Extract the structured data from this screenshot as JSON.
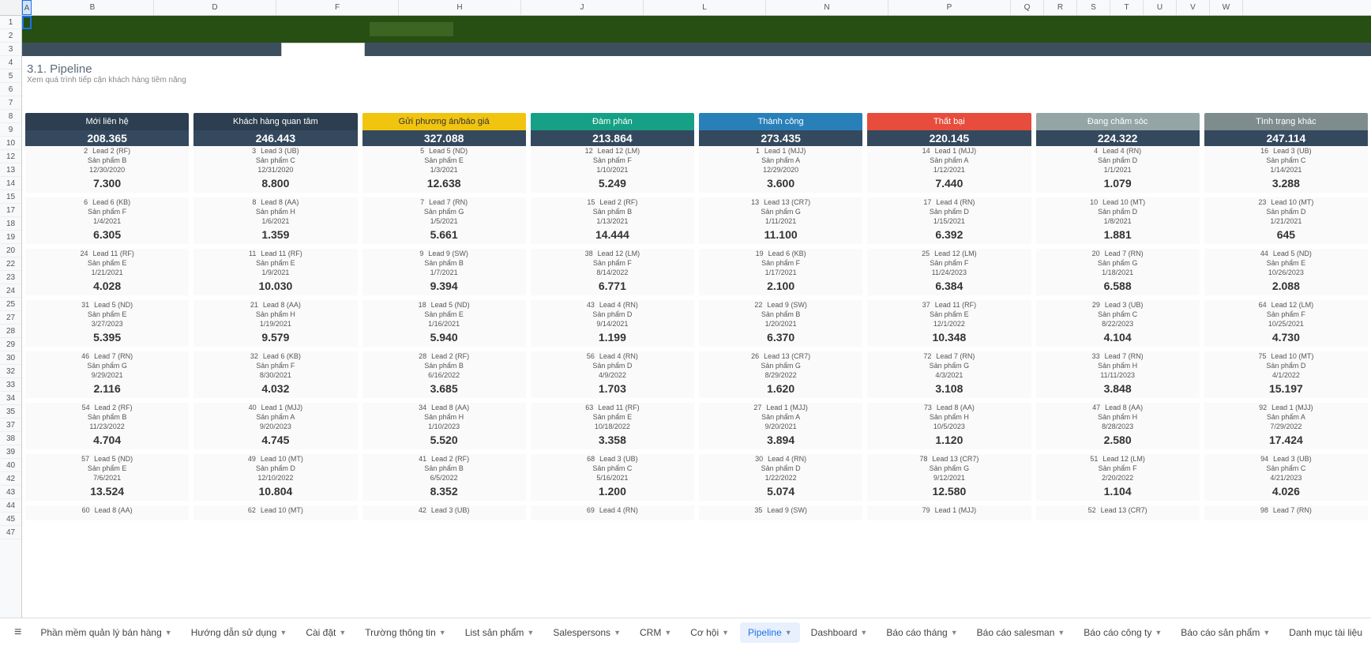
{
  "col_letters": [
    "A",
    "B",
    "D",
    "F",
    "H",
    "J",
    "L",
    "N",
    "P",
    "Q",
    "R",
    "S",
    "T",
    "U",
    "V",
    "W"
  ],
  "row_numbers": [
    1,
    2,
    3,
    4,
    5,
    6,
    7,
    8,
    9,
    10,
    12,
    13,
    14,
    15,
    17,
    18,
    19,
    20,
    22,
    23,
    24,
    25,
    27,
    28,
    29,
    30,
    32,
    33,
    34,
    35,
    37,
    38,
    39,
    40,
    42,
    43,
    44,
    45,
    47
  ],
  "section": {
    "title": "3.1. Pipeline",
    "subtitle": "Xem quá trình tiếp cận khách hàng tiềm năng"
  },
  "stages": [
    {
      "name": "Mới liên hệ",
      "total": "208.365",
      "hclass": "c1",
      "cards": [
        {
          "n": "2",
          "lead": "Lead 2 (RF)",
          "prod": "Sản phẩm B",
          "date": "12/30/2020",
          "val": "7.300"
        },
        {
          "n": "6",
          "lead": "Lead 6 (KB)",
          "prod": "Sản phẩm F",
          "date": "1/4/2021",
          "val": "6.305"
        },
        {
          "n": "24",
          "lead": "Lead 11 (RF)",
          "prod": "Sản phẩm E",
          "date": "1/21/2021",
          "val": "4.028"
        },
        {
          "n": "31",
          "lead": "Lead 5 (ND)",
          "prod": "Sản phẩm E",
          "date": "3/27/2023",
          "val": "5.395"
        },
        {
          "n": "46",
          "lead": "Lead 7 (RN)",
          "prod": "Sản phẩm G",
          "date": "9/29/2021",
          "val": "2.116"
        },
        {
          "n": "54",
          "lead": "Lead 2 (RF)",
          "prod": "Sản phẩm B",
          "date": "11/23/2022",
          "val": "4.704"
        },
        {
          "n": "57",
          "lead": "Lead 5 (ND)",
          "prod": "Sản phẩm E",
          "date": "7/6/2021",
          "val": "13.524"
        },
        {
          "n": "60",
          "lead": "Lead 8 (AA)",
          "prod": "",
          "date": "",
          "val": ""
        }
      ]
    },
    {
      "name": "Khách hàng quan tâm",
      "total": "246.443",
      "hclass": "c2",
      "cards": [
        {
          "n": "3",
          "lead": "Lead 3 (UB)",
          "prod": "Sản phẩm C",
          "date": "12/31/2020",
          "val": "8.800"
        },
        {
          "n": "8",
          "lead": "Lead 8 (AA)",
          "prod": "Sản phẩm H",
          "date": "1/6/2021",
          "val": "1.359"
        },
        {
          "n": "11",
          "lead": "Lead 11 (RF)",
          "prod": "Sản phẩm E",
          "date": "1/9/2021",
          "val": "10.030"
        },
        {
          "n": "21",
          "lead": "Lead 8 (AA)",
          "prod": "Sản phẩm H",
          "date": "1/19/2021",
          "val": "9.579"
        },
        {
          "n": "32",
          "lead": "Lead 6 (KB)",
          "prod": "Sản phẩm F",
          "date": "8/30/2021",
          "val": "4.032"
        },
        {
          "n": "40",
          "lead": "Lead 1 (MJJ)",
          "prod": "Sản phẩm A",
          "date": "9/20/2023",
          "val": "4.745"
        },
        {
          "n": "49",
          "lead": "Lead 10 (MT)",
          "prod": "Sản phẩm D",
          "date": "12/10/2022",
          "val": "10.804"
        },
        {
          "n": "62",
          "lead": "Lead 10 (MT)",
          "prod": "",
          "date": "",
          "val": ""
        }
      ]
    },
    {
      "name": "Gửi phương án/báo giá",
      "total": "327.088",
      "hclass": "c3",
      "cards": [
        {
          "n": "5",
          "lead": "Lead 5 (ND)",
          "prod": "Sản phẩm E",
          "date": "1/3/2021",
          "val": "12.638"
        },
        {
          "n": "7",
          "lead": "Lead 7 (RN)",
          "prod": "Sản phẩm G",
          "date": "1/5/2021",
          "val": "5.661"
        },
        {
          "n": "9",
          "lead": "Lead 9 (SW)",
          "prod": "Sản phẩm B",
          "date": "1/7/2021",
          "val": "9.394"
        },
        {
          "n": "18",
          "lead": "Lead 5 (ND)",
          "prod": "Sản phẩm E",
          "date": "1/16/2021",
          "val": "5.940"
        },
        {
          "n": "28",
          "lead": "Lead 2 (RF)",
          "prod": "Sản phẩm B",
          "date": "6/16/2022",
          "val": "3.685"
        },
        {
          "n": "34",
          "lead": "Lead 8 (AA)",
          "prod": "Sản phẩm H",
          "date": "1/10/2023",
          "val": "5.520"
        },
        {
          "n": "41",
          "lead": "Lead 2 (RF)",
          "prod": "Sản phẩm B",
          "date": "6/5/2022",
          "val": "8.352"
        },
        {
          "n": "42",
          "lead": "Lead 3 (UB)",
          "prod": "",
          "date": "",
          "val": ""
        }
      ]
    },
    {
      "name": "Đàm phán",
      "total": "213.864",
      "hclass": "c4",
      "cards": [
        {
          "n": "12",
          "lead": "Lead 12 (LM)",
          "prod": "Sản phẩm F",
          "date": "1/10/2021",
          "val": "5.249"
        },
        {
          "n": "15",
          "lead": "Lead 2 (RF)",
          "prod": "Sản phẩm B",
          "date": "1/13/2021",
          "val": "14.444"
        },
        {
          "n": "38",
          "lead": "Lead 12 (LM)",
          "prod": "Sản phẩm F",
          "date": "8/14/2022",
          "val": "6.771"
        },
        {
          "n": "43",
          "lead": "Lead 4 (RN)",
          "prod": "Sản phẩm D",
          "date": "9/14/2021",
          "val": "1.199"
        },
        {
          "n": "56",
          "lead": "Lead 4 (RN)",
          "prod": "Sản phẩm D",
          "date": "4/9/2022",
          "val": "1.703"
        },
        {
          "n": "63",
          "lead": "Lead 11 (RF)",
          "prod": "Sản phẩm E",
          "date": "10/18/2022",
          "val": "3.358"
        },
        {
          "n": "68",
          "lead": "Lead 3 (UB)",
          "prod": "Sản phẩm C",
          "date": "5/16/2021",
          "val": "1.200"
        },
        {
          "n": "69",
          "lead": "Lead 4 (RN)",
          "prod": "",
          "date": "",
          "val": ""
        }
      ]
    },
    {
      "name": "Thành công",
      "total": "273.435",
      "hclass": "c5",
      "cards": [
        {
          "n": "1",
          "lead": "Lead 1 (MJJ)",
          "prod": "Sản phẩm A",
          "date": "12/29/2020",
          "val": "3.600"
        },
        {
          "n": "13",
          "lead": "Lead 13 (CR7)",
          "prod": "Sản phẩm G",
          "date": "1/11/2021",
          "val": "11.100"
        },
        {
          "n": "19",
          "lead": "Lead 6 (KB)",
          "prod": "Sản phẩm F",
          "date": "1/17/2021",
          "val": "2.100"
        },
        {
          "n": "22",
          "lead": "Lead 9 (SW)",
          "prod": "Sản phẩm B",
          "date": "1/20/2021",
          "val": "6.370"
        },
        {
          "n": "26",
          "lead": "Lead 13 (CR7)",
          "prod": "Sản phẩm G",
          "date": "8/29/2022",
          "val": "1.620"
        },
        {
          "n": "27",
          "lead": "Lead 1 (MJJ)",
          "prod": "Sản phẩm A",
          "date": "9/20/2021",
          "val": "3.894"
        },
        {
          "n": "30",
          "lead": "Lead 4 (RN)",
          "prod": "Sản phẩm D",
          "date": "1/22/2022",
          "val": "5.074"
        },
        {
          "n": "35",
          "lead": "Lead 9 (SW)",
          "prod": "",
          "date": "",
          "val": ""
        }
      ]
    },
    {
      "name": "Thất bại",
      "total": "220.145",
      "hclass": "c6",
      "cards": [
        {
          "n": "14",
          "lead": "Lead 1 (MJJ)",
          "prod": "Sản phẩm A",
          "date": "1/12/2021",
          "val": "7.440"
        },
        {
          "n": "17",
          "lead": "Lead 4 (RN)",
          "prod": "Sản phẩm D",
          "date": "1/15/2021",
          "val": "6.392"
        },
        {
          "n": "25",
          "lead": "Lead 12 (LM)",
          "prod": "Sản phẩm F",
          "date": "11/24/2023",
          "val": "6.384"
        },
        {
          "n": "37",
          "lead": "Lead 11 (RF)",
          "prod": "Sản phẩm E",
          "date": "12/1/2022",
          "val": "10.348"
        },
        {
          "n": "72",
          "lead": "Lead 7 (RN)",
          "prod": "Sản phẩm G",
          "date": "4/3/2021",
          "val": "3.108"
        },
        {
          "n": "73",
          "lead": "Lead 8 (AA)",
          "prod": "Sản phẩm H",
          "date": "10/5/2023",
          "val": "1.120"
        },
        {
          "n": "78",
          "lead": "Lead 13 (CR7)",
          "prod": "Sản phẩm G",
          "date": "9/12/2021",
          "val": "12.580"
        },
        {
          "n": "79",
          "lead": "Lead 1 (MJJ)",
          "prod": "",
          "date": "",
          "val": ""
        }
      ]
    },
    {
      "name": "Đang chăm sóc",
      "total": "224.322",
      "hclass": "c7",
      "cards": [
        {
          "n": "4",
          "lead": "Lead 4 (RN)",
          "prod": "Sản phẩm D",
          "date": "1/1/2021",
          "val": "1.079"
        },
        {
          "n": "10",
          "lead": "Lead 10 (MT)",
          "prod": "Sản phẩm D",
          "date": "1/8/2021",
          "val": "1.881"
        },
        {
          "n": "20",
          "lead": "Lead 7 (RN)",
          "prod": "Sản phẩm G",
          "date": "1/18/2021",
          "val": "6.588"
        },
        {
          "n": "29",
          "lead": "Lead 3 (UB)",
          "prod": "Sản phẩm C",
          "date": "8/22/2023",
          "val": "4.104"
        },
        {
          "n": "33",
          "lead": "Lead 7 (RN)",
          "prod": "Sản phẩm H",
          "date": "11/11/2023",
          "val": "3.848"
        },
        {
          "n": "47",
          "lead": "Lead 8 (AA)",
          "prod": "Sản phẩm H",
          "date": "8/28/2023",
          "val": "2.580"
        },
        {
          "n": "51",
          "lead": "Lead 12 (LM)",
          "prod": "Sản phẩm F",
          "date": "2/20/2022",
          "val": "1.104"
        },
        {
          "n": "52",
          "lead": "Lead 13 (CR7)",
          "prod": "",
          "date": "",
          "val": ""
        }
      ]
    },
    {
      "name": "Tình trạng khác",
      "total": "247.114",
      "hclass": "c8",
      "cards": [
        {
          "n": "16",
          "lead": "Lead 3 (UB)",
          "prod": "Sản phẩm C",
          "date": "1/14/2021",
          "val": "3.288"
        },
        {
          "n": "23",
          "lead": "Lead 10 (MT)",
          "prod": "Sản phẩm D",
          "date": "1/21/2021",
          "val": "645"
        },
        {
          "n": "44",
          "lead": "Lead 5 (ND)",
          "prod": "Sản phẩm E",
          "date": "10/26/2023",
          "val": "2.088"
        },
        {
          "n": "64",
          "lead": "Lead 12 (LM)",
          "prod": "Sản phẩm F",
          "date": "10/25/2021",
          "val": "4.730"
        },
        {
          "n": "75",
          "lead": "Lead 10 (MT)",
          "prod": "Sản phẩm D",
          "date": "4/1/2022",
          "val": "15.197"
        },
        {
          "n": "92",
          "lead": "Lead 1 (MJJ)",
          "prod": "Sản phẩm A",
          "date": "7/29/2022",
          "val": "17.424"
        },
        {
          "n": "94",
          "lead": "Lead 3 (UB)",
          "prod": "Sản phẩm C",
          "date": "4/21/2023",
          "val": "4.026"
        },
        {
          "n": "98",
          "lead": "Lead 7 (RN)",
          "prod": "",
          "date": "",
          "val": ""
        }
      ]
    }
  ],
  "tabs": [
    {
      "label": "Phần mềm quản lý bán hàng",
      "active": false
    },
    {
      "label": "Hướng dẫn sử dụng",
      "active": false
    },
    {
      "label": "Cài đặt",
      "active": false
    },
    {
      "label": "Trường thông tin",
      "active": false
    },
    {
      "label": "List sản phẩm",
      "active": false
    },
    {
      "label": "Salespersons",
      "active": false
    },
    {
      "label": "CRM",
      "active": false
    },
    {
      "label": "Cơ hội",
      "active": false
    },
    {
      "label": "Pipeline",
      "active": true
    },
    {
      "label": "Dashboard",
      "active": false
    },
    {
      "label": "Báo cáo tháng",
      "active": false
    },
    {
      "label": "Báo cáo salesman",
      "active": false
    },
    {
      "label": "Báo cáo công ty",
      "active": false
    },
    {
      "label": "Báo cáo sản phẩm",
      "active": false
    },
    {
      "label": "Danh mục tài liệu tham khảo",
      "active": false
    }
  ]
}
